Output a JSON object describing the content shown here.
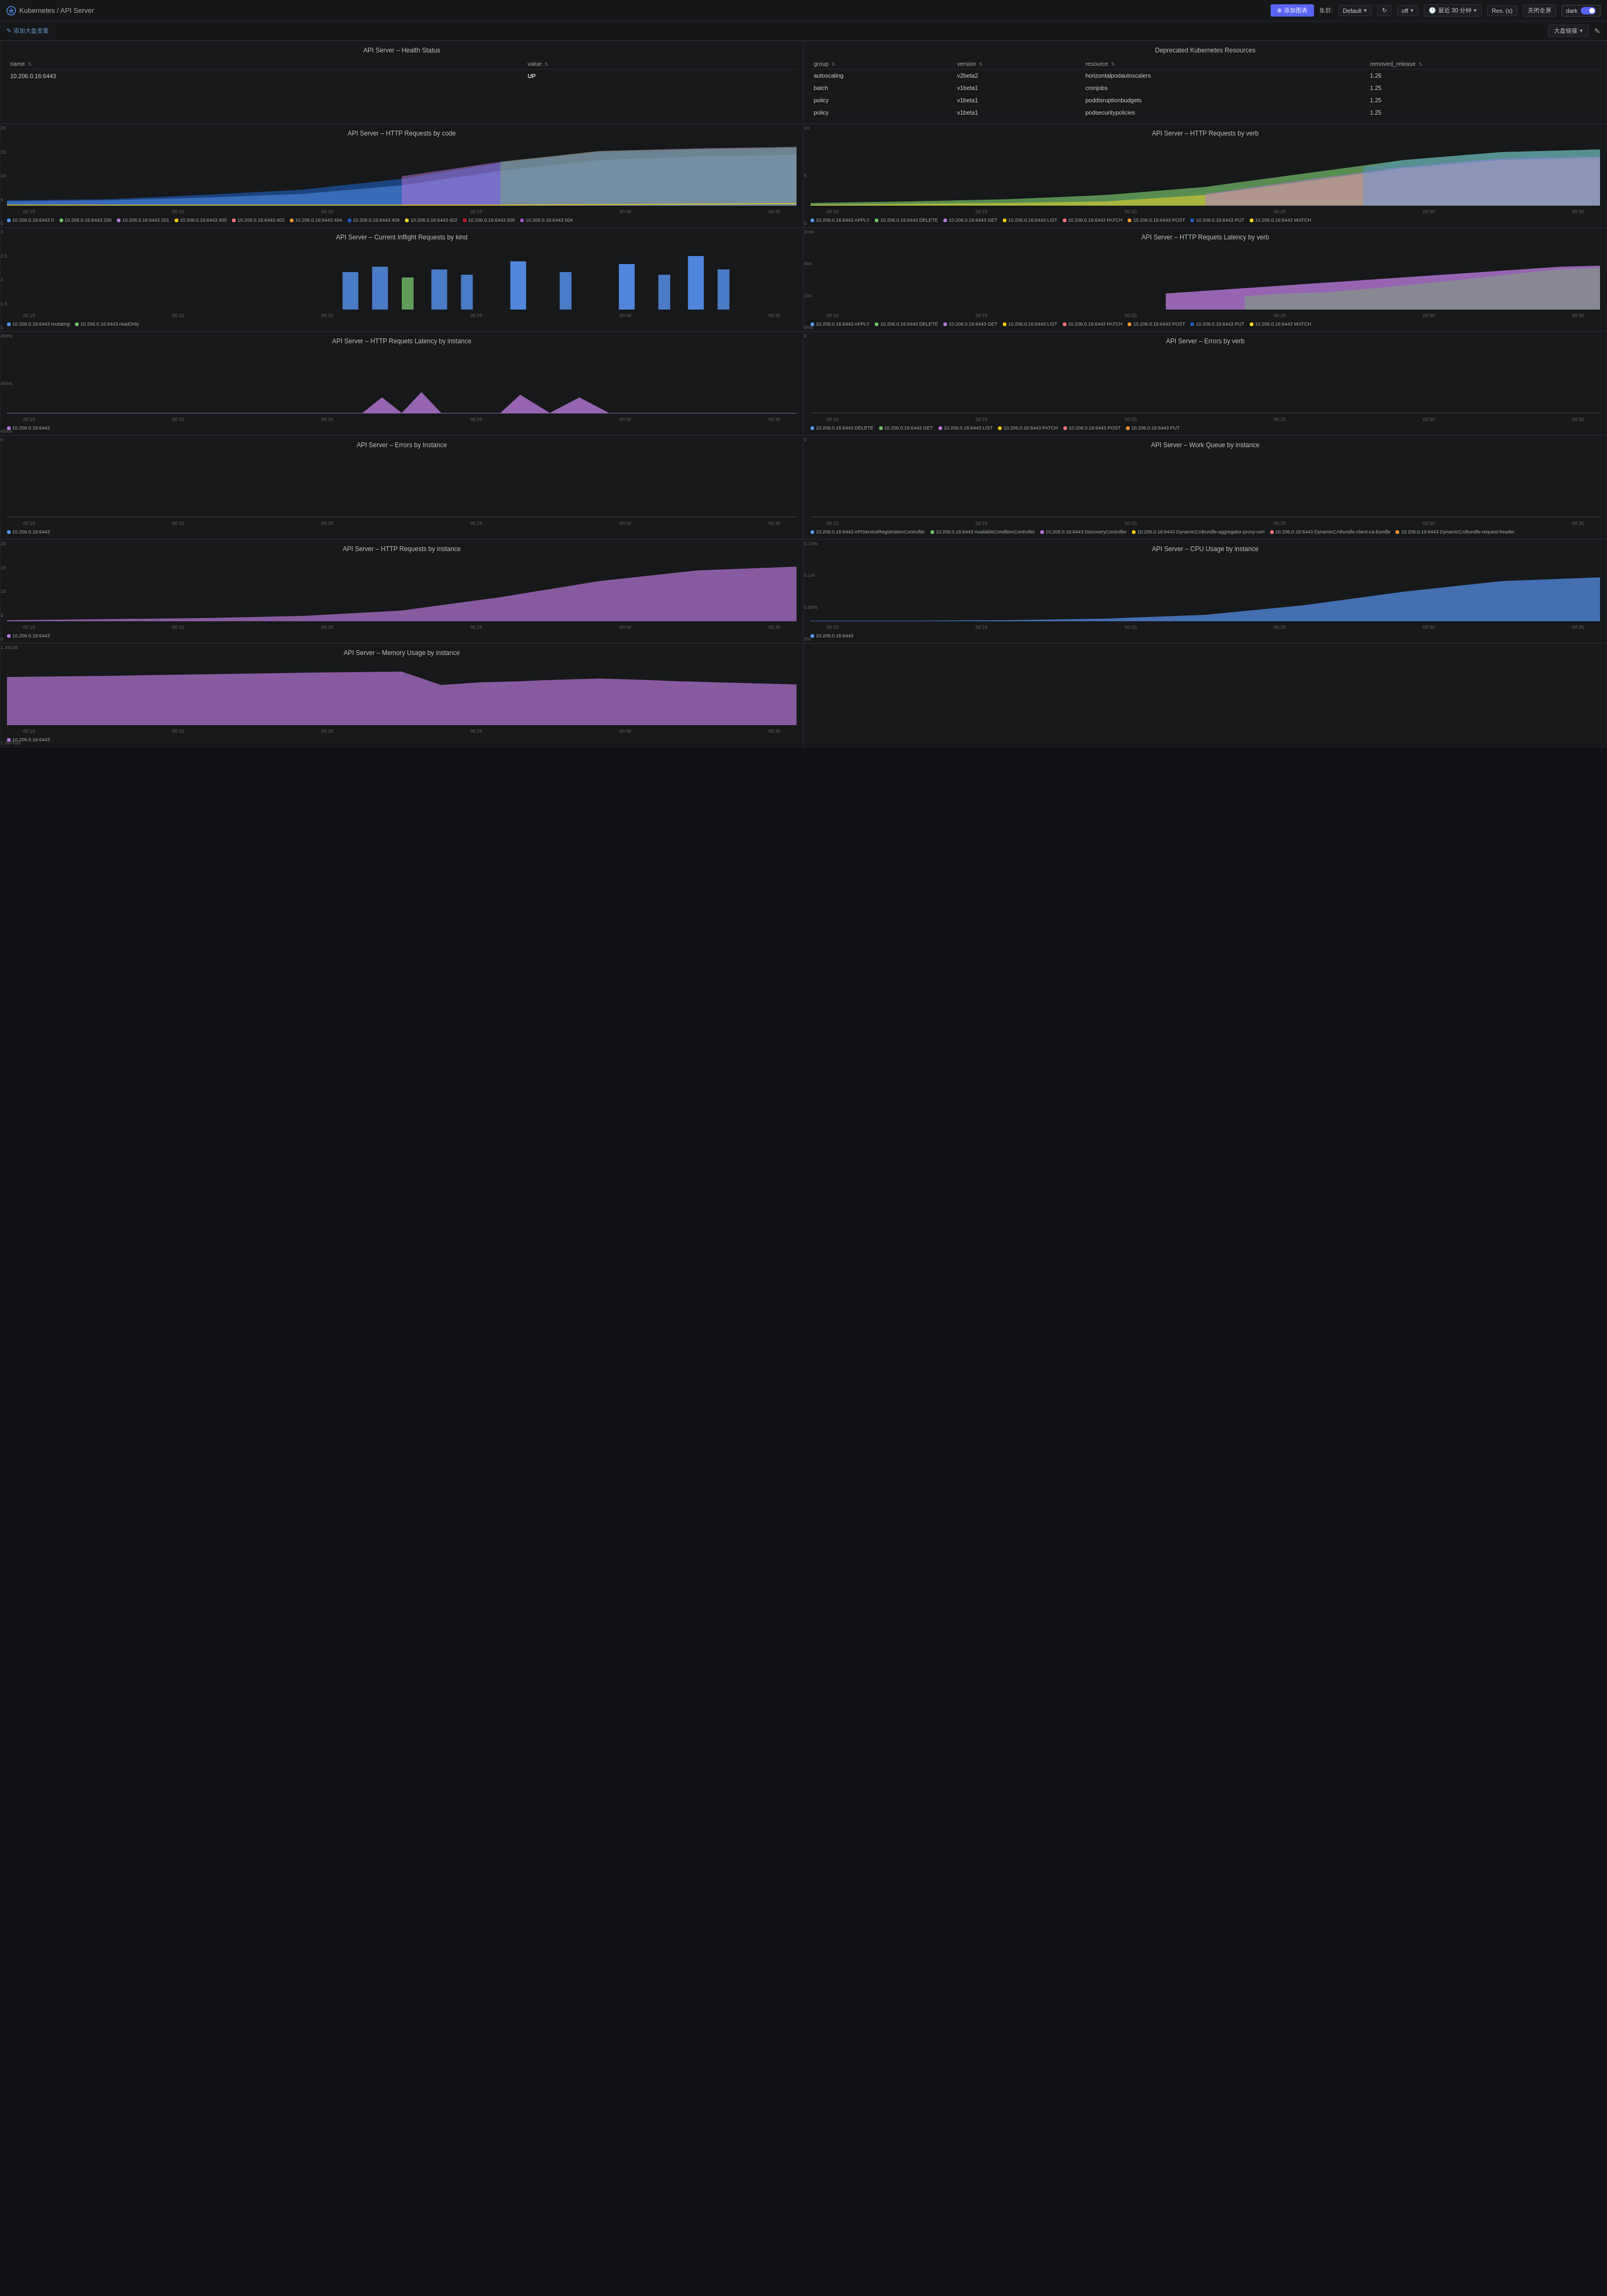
{
  "topbar": {
    "logo": "Kubernetes / API Server",
    "add_button": "添加图表",
    "cluster_label": "集群:",
    "cluster_value": "Default",
    "refresh_label": "off",
    "time_range": "最近 30 分钟",
    "res_label": "Res. (s)",
    "close_full": "关闭全屏",
    "theme": "dark"
  },
  "subbar": {
    "add_variable": "添加大盘变量",
    "dash_link": "大盘链接",
    "edit_icon": "✎"
  },
  "panels": {
    "health_status": {
      "title": "API Server – Health Status",
      "columns": [
        "name",
        "value"
      ],
      "rows": [
        {
          "name": "10.206.0.16:6443",
          "value": "UP"
        }
      ]
    },
    "deprecated_resources": {
      "title": "Deprecated Kubernetes Resources",
      "columns": [
        "group",
        "version",
        "resource",
        "removed_release"
      ],
      "rows": [
        {
          "group": "autoscaling",
          "version": "v2beta2",
          "resource": "horizontalpodautoscalers",
          "removed_release": "1.26"
        },
        {
          "group": "batch",
          "version": "v1beta1",
          "resource": "cronjobs",
          "removed_release": "1.25"
        },
        {
          "group": "policy",
          "version": "v1beta1",
          "resource": "poddisruptionbudgets",
          "removed_release": "1.25"
        },
        {
          "group": "policy",
          "version": "v1beta1",
          "resource": "podsecuritypolicies",
          "removed_release": "1.25"
        }
      ]
    },
    "http_requests_by_code": {
      "title": "API Server – HTTP Requests by code",
      "yaxis": [
        "20",
        "15",
        "10",
        "5",
        "0"
      ],
      "xaxis": [
        "00:10",
        "00:15",
        "00:20",
        "00:25",
        "00:30",
        "00:35"
      ],
      "legend": [
        {
          "label": "10.206.0.16:6443 0",
          "color": "#5794f2"
        },
        {
          "label": "10.206.0.16:6443 200",
          "color": "#73bf69"
        },
        {
          "label": "10.206.0.16:6443 201",
          "color": "#b877d9"
        },
        {
          "label": "10.206.0.16:6443 400",
          "color": "#f2cc0c"
        },
        {
          "label": "10.206.0.16:6443 403",
          "color": "#ff7383"
        },
        {
          "label": "10.206.0.16:6443 404",
          "color": "#ff9830"
        },
        {
          "label": "10.206.0.16:6443 409",
          "color": "#1f60c4"
        },
        {
          "label": "10.206.0.16:6443 422",
          "color": "#fade2a"
        },
        {
          "label": "10.206.0.16:6443 500",
          "color": "#c4162a"
        },
        {
          "label": "10.206.0.16:6443 504",
          "color": "#a352cc"
        }
      ]
    },
    "http_requests_by_verb": {
      "title": "API Server – HTTP Requests by verb",
      "yaxis": [
        "10",
        "5",
        "0"
      ],
      "xaxis": [
        "00:10",
        "00:15",
        "00:20",
        "00:25",
        "00:30",
        "00:35"
      ],
      "legend": [
        {
          "label": "10.206.0.16:6443 APPLY",
          "color": "#5794f2"
        },
        {
          "label": "10.206.0.16:6443 DELETE",
          "color": "#73bf69"
        },
        {
          "label": "10.206.0.16:6443 GET",
          "color": "#b877d9"
        },
        {
          "label": "10.206.0.16:6443 LIST",
          "color": "#f2cc0c"
        },
        {
          "label": "10.206.0.16:6443 PATCH",
          "color": "#ff7383"
        },
        {
          "label": "10.206.0.16:6443 POST",
          "color": "#ff9830"
        },
        {
          "label": "10.206.0.16:6443 PUT",
          "color": "#1f60c4"
        },
        {
          "label": "10.206.0.16:6443 WATCH",
          "color": "#fade2a"
        }
      ]
    },
    "current_inflight": {
      "title": "API Server – Current Inflight Requests by kind",
      "yaxis": [
        "3",
        "2.5",
        "2",
        "1.5",
        "1"
      ],
      "xaxis": [
        "00:10",
        "00:15",
        "00:20",
        "00:25",
        "00:30",
        "00:35"
      ],
      "legend": [
        {
          "label": "10.206.0.16:6443 mutating",
          "color": "#5794f2"
        },
        {
          "label": "10.206.0.16:6443 readOnly",
          "color": "#73bf69"
        }
      ]
    },
    "http_latency_by_verb": {
      "title": "API Server – HTTP Requets Latency by verb",
      "yaxis": [
        "1min",
        "40s",
        "20s",
        "0ms"
      ],
      "xaxis": [
        "00:10",
        "00:15",
        "00:20",
        "00:25",
        "00:30",
        "00:35"
      ],
      "legend": [
        {
          "label": "10.206.0.16:6443 APPLY",
          "color": "#5794f2"
        },
        {
          "label": "10.206.0.16:6443 DELETE",
          "color": "#73bf69"
        },
        {
          "label": "10.206.0.16:6443 GET",
          "color": "#b877d9"
        },
        {
          "label": "10.206.0.16:6443 LIST",
          "color": "#f2cc0c"
        },
        {
          "label": "10.206.0.16:6443 PATCH",
          "color": "#ff7383"
        },
        {
          "label": "10.206.0.16:6443 POST",
          "color": "#ff9830"
        },
        {
          "label": "10.206.0.16:6443 PUT",
          "color": "#1f60c4"
        },
        {
          "label": "10.206.0.16:6443 WATCH",
          "color": "#fade2a"
        }
      ]
    },
    "http_latency_by_instance": {
      "title": "API Server – HTTP Requets Latency by instance",
      "yaxis": [
        "45ms",
        "45ms",
        "45ms"
      ],
      "xaxis": [
        "00:10",
        "00:15",
        "00:20",
        "00:25",
        "00:30",
        "00:35"
      ],
      "legend": [
        {
          "label": "10.206.0.16:6443",
          "color": "#b877d9"
        }
      ]
    },
    "errors_by_verb": {
      "title": "API Server – Errors by verb",
      "yaxis": [
        "0"
      ],
      "xaxis": [
        "00:10",
        "00:15",
        "00:20",
        "00:25",
        "00:30",
        "00:35"
      ],
      "legend": [
        {
          "label": "10.206.0.16:6443 DELETE",
          "color": "#5794f2"
        },
        {
          "label": "10.206.0.16:6443 GET",
          "color": "#73bf69"
        },
        {
          "label": "10.206.0.16:6443 LIST",
          "color": "#b877d9"
        },
        {
          "label": "10.206.0.16:6443 PATCH",
          "color": "#f2cc0c"
        },
        {
          "label": "10.206.0.16:6443 POST",
          "color": "#ff7383"
        },
        {
          "label": "10.206.0.16:6443 PUT",
          "color": "#ff9830"
        }
      ]
    },
    "errors_by_instance": {
      "title": "API Server – Errors by Instance",
      "yaxis": [
        "0"
      ],
      "xaxis": [
        "00:10",
        "00:15",
        "00:20",
        "00:25",
        "00:30",
        "00:35"
      ],
      "legend": [
        {
          "label": "10.206.0.16:6443",
          "color": "#5794f2"
        }
      ]
    },
    "work_queue": {
      "title": "API Server – Work Queue by instance",
      "yaxis": [
        "0"
      ],
      "xaxis": [
        "00:10",
        "00:15",
        "00:20",
        "00:25",
        "00:30",
        "00:35"
      ],
      "legend": [
        {
          "label": "10.206.0.16:6443 APIServiceRegistrationController",
          "color": "#5794f2"
        },
        {
          "label": "10.206.0.16:6443 AvailableConditionController",
          "color": "#73bf69"
        },
        {
          "label": "10.206.0.16:6443 DiscoveryController",
          "color": "#b877d9"
        },
        {
          "label": "10.206.0.16:6443 DynamicCABundle-aggregator-proxy-cert",
          "color": "#f2cc0c"
        },
        {
          "label": "10.206.0.16:6443 DynamicCABundle-client-ca-bundle",
          "color": "#ff7383"
        },
        {
          "label": "10.206.0.16:6443 DynamicCABundle-request-header",
          "color": "#ff9830"
        }
      ]
    },
    "http_requests_by_instance": {
      "title": "API Server – HTTP Requests by instance",
      "yaxis": [
        "20",
        "15",
        "10",
        "5",
        "0"
      ],
      "xaxis": [
        "00:10",
        "00:15",
        "00:20",
        "00:25",
        "00:30",
        "00:35"
      ],
      "legend": [
        {
          "label": "10.206.0.16:6443",
          "color": "#b877d9"
        }
      ]
    },
    "cpu_usage": {
      "title": "API Server – CPU Usage by instance",
      "yaxis": [
        "0.15%",
        "0.1%",
        "0.05%",
        "0%"
      ],
      "xaxis": [
        "00:10",
        "00:15",
        "00:20",
        "00:25",
        "00:30",
        "00:35"
      ],
      "legend": [
        {
          "label": "10.206.0.16:6443",
          "color": "#5794f2"
        }
      ]
    },
    "memory_usage": {
      "title": "API Server – Memory Usage by instance",
      "yaxis": [
        "1.49GiB",
        "1.397GiB"
      ],
      "xaxis": [
        "00:10",
        "00:15",
        "00:20",
        "00:25",
        "00:30",
        "00:35"
      ],
      "legend": [
        {
          "label": "10.206.0.16:6443",
          "color": "#b877d9"
        }
      ]
    }
  }
}
